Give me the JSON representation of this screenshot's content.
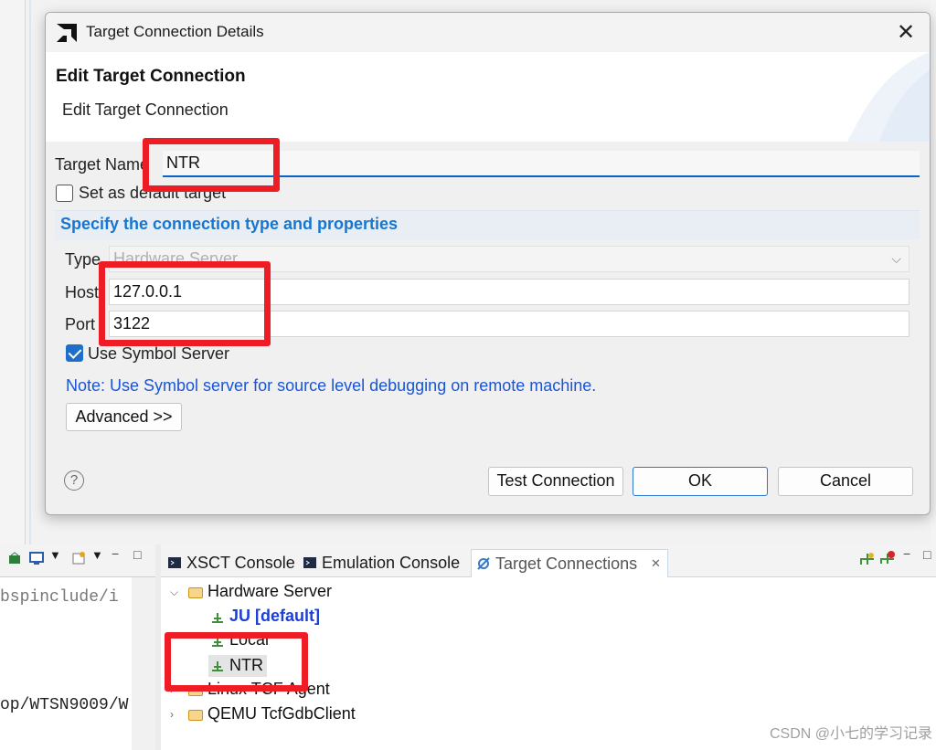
{
  "dialog": {
    "title": "Target Connection Details",
    "close": "✕",
    "banner_title": "Edit Target Connection",
    "banner_subtitle": "Edit Target Connection",
    "target_name_label": "Target Name",
    "target_name_value": "NTR",
    "default_target_label": "Set as default target",
    "default_target_checked": false,
    "section_title": "Specify the connection type and properties",
    "type_label": "Type",
    "type_value": "Hardware Server",
    "host_label": "Host",
    "host_value": "127.0.0.1",
    "port_label": "Port",
    "port_value": "3122",
    "symbol_server_label": "Use Symbol Server",
    "symbol_server_checked": true,
    "note": "Note: Use Symbol server for source level debugging on remote machine.",
    "advanced_button": "Advanced >>",
    "help": "?",
    "test_button": "Test Connection",
    "ok_button": "OK",
    "cancel_button": "Cancel"
  },
  "left_panel": {
    "lines": [
      "bspinclude/i",
      "",
      "",
      "op/WTSN9009/W"
    ]
  },
  "tabs": [
    {
      "label": "XSCT Console"
    },
    {
      "label": "Emulation Console"
    },
    {
      "label": "Target Connections",
      "close": "✕"
    }
  ],
  "tree": [
    {
      "label": "Hardware Server",
      "expanded": true
    },
    {
      "label": "JU [default]"
    },
    {
      "label": "Local"
    },
    {
      "label": "NTR"
    },
    {
      "label": "Linux TCF Agent"
    },
    {
      "label": "QEMU TcfGdbClient"
    }
  ],
  "watermark": "CSDN @小七的学习记录",
  "colors": {
    "accent": "#1677d2",
    "highlight_box": "#ee1c25",
    "note": "#1955d6"
  }
}
